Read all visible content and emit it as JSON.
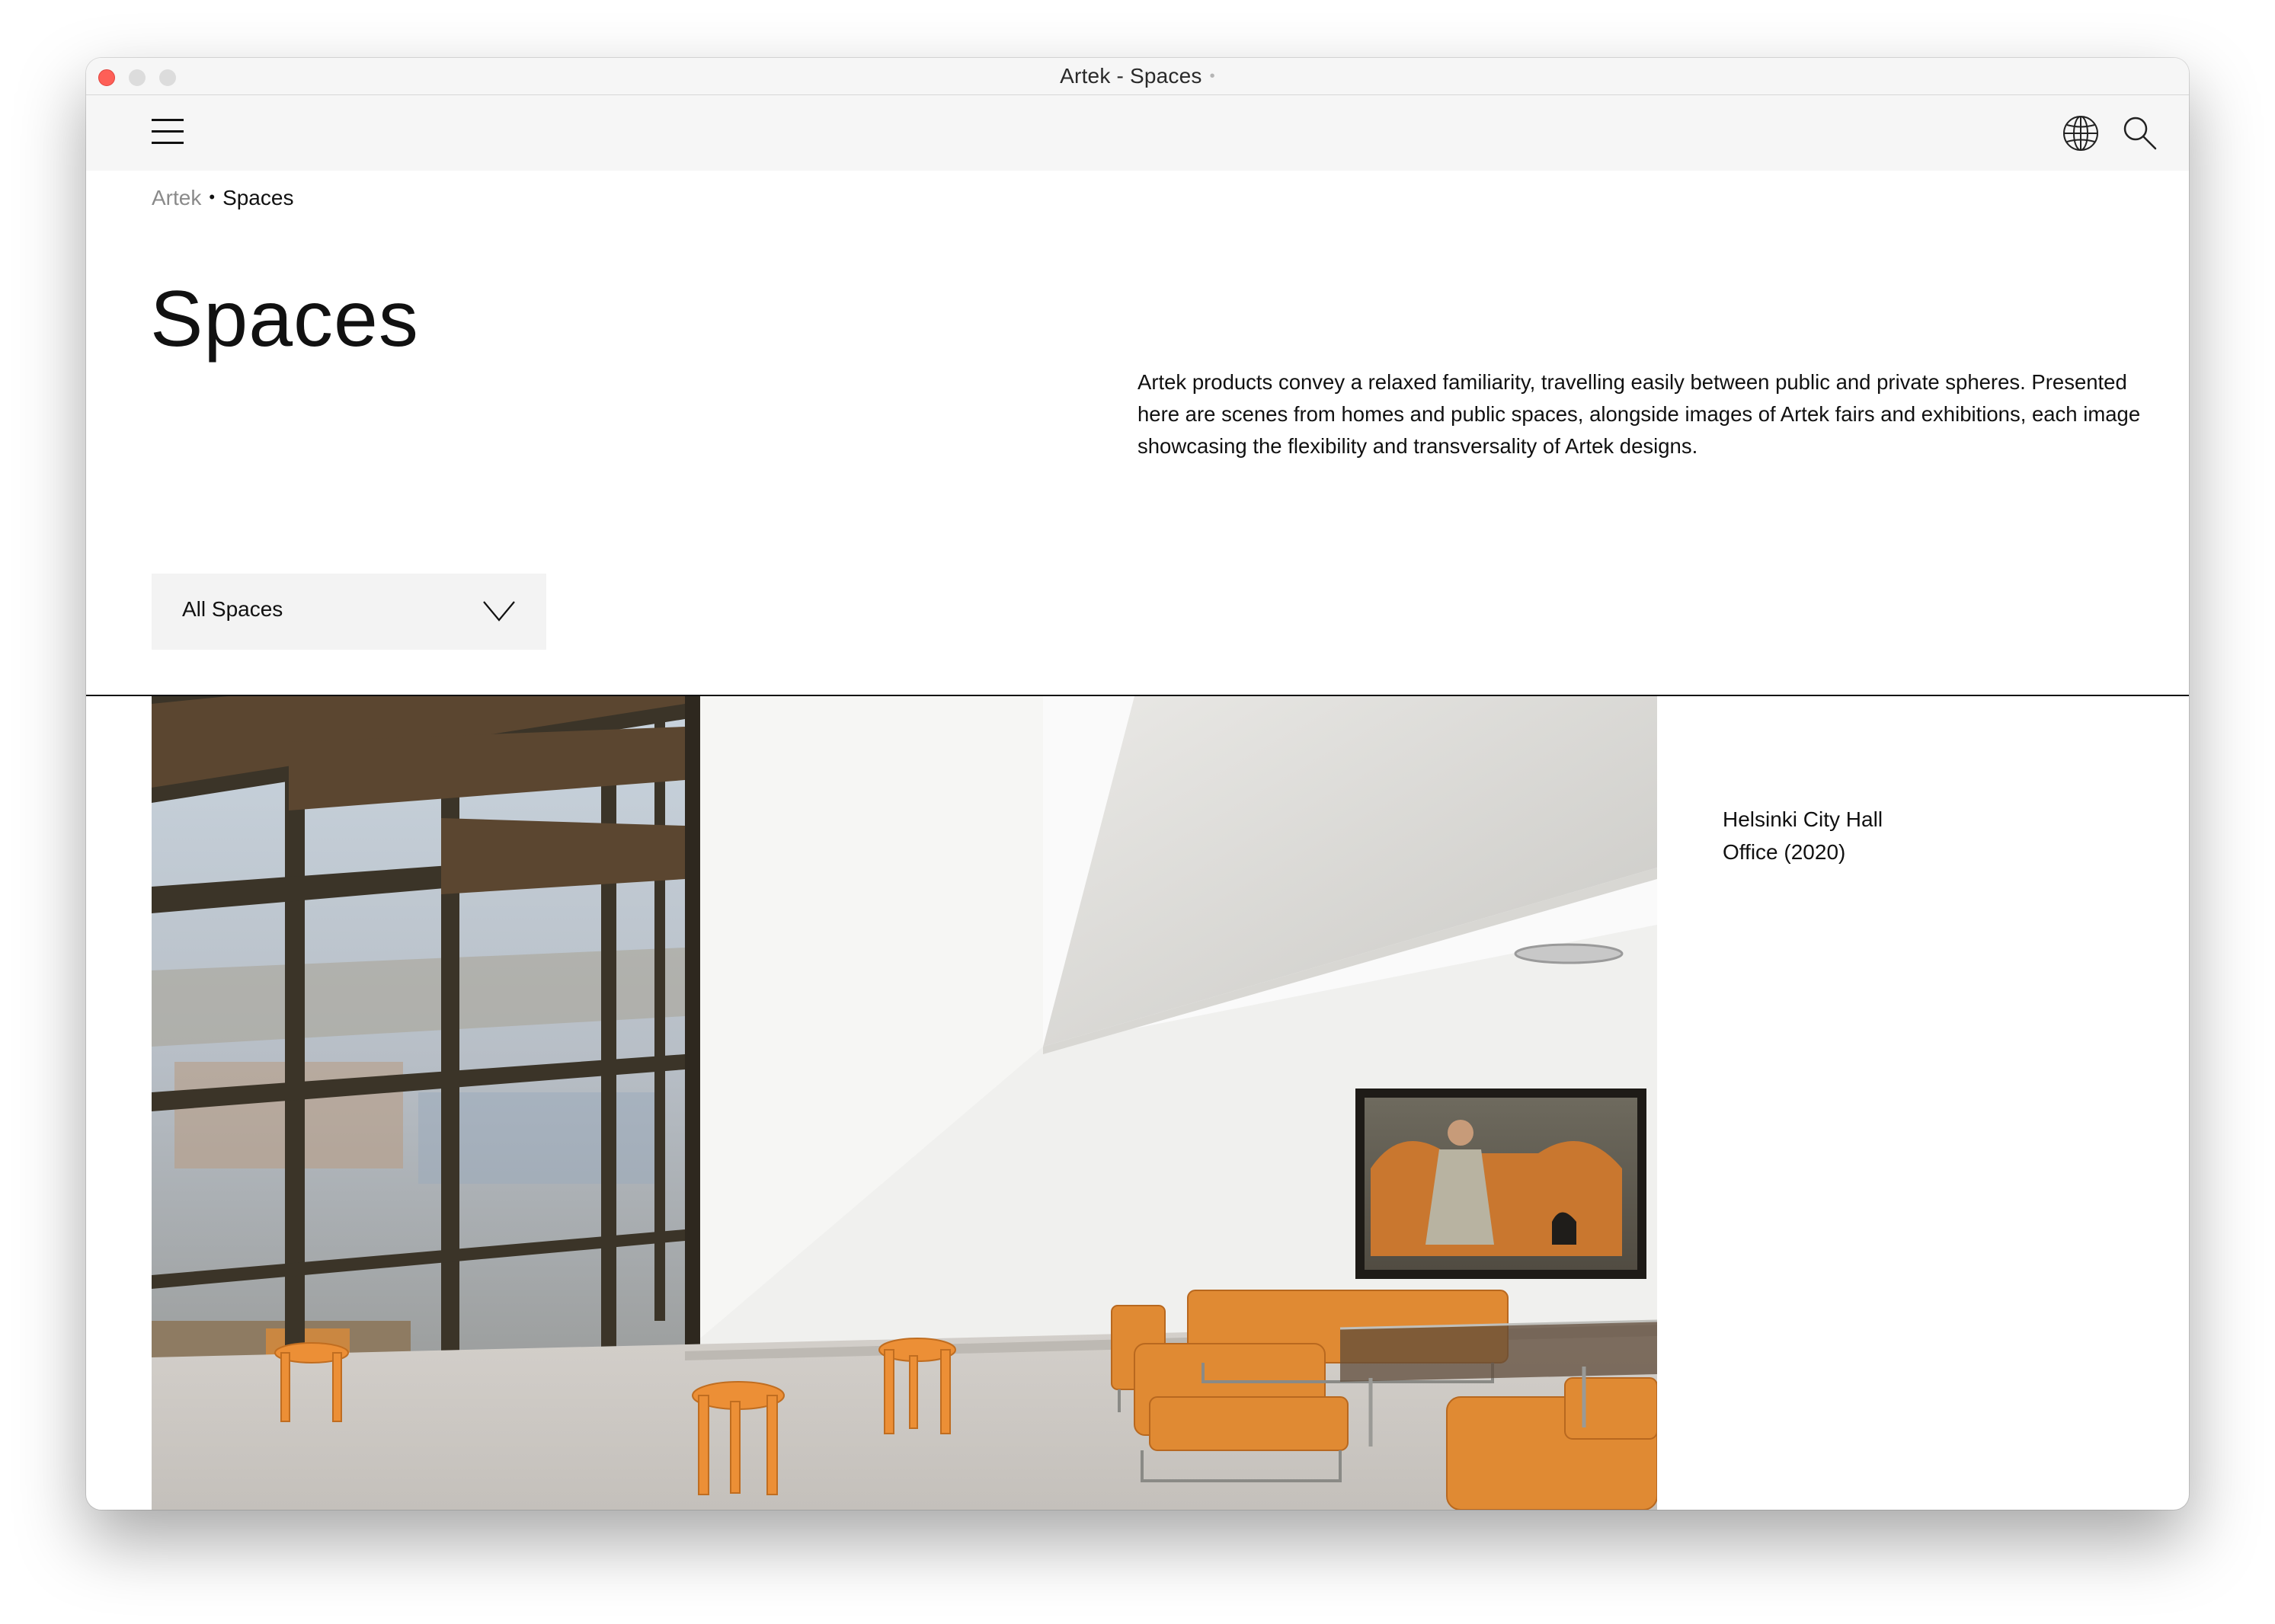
{
  "window": {
    "title": "Artek - Spaces",
    "title_dot": "•"
  },
  "nav": {
    "menu_icon": "hamburger-menu-icon",
    "language_icon": "globe-icon",
    "search_icon": "search-icon"
  },
  "breadcrumb": {
    "root": "Artek",
    "separator": "•",
    "current": "Spaces"
  },
  "page": {
    "title": "Spaces",
    "intro": "Artek products convey a relaxed familiarity, travelling easily between public and private spheres. Presented here are scenes from homes and public spaces, alongside images of Artek fairs and exhibitions, each image showcasing the flexibility and transversality of Artek designs."
  },
  "filter": {
    "selected": "All Spaces",
    "icon": "chevron-down-icon"
  },
  "feature": {
    "caption_line1": "Helsinki City Hall",
    "caption_line2": "Office (2020)"
  },
  "colors": {
    "close_button": "#fe5f57",
    "chrome": "#f6f6f6",
    "filter_bg": "#f3f3f3",
    "accent_orange": "#e58a2f",
    "text": "#111111"
  }
}
